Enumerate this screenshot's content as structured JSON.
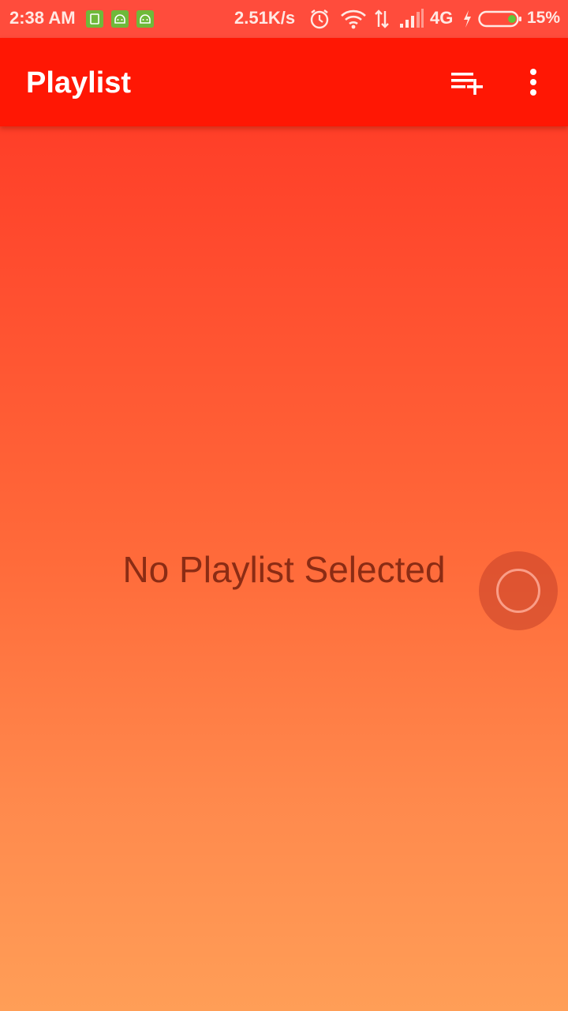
{
  "status_bar": {
    "time": "2:38 AM",
    "notification_icons": [
      "sim-card-icon",
      "android-icon",
      "android-icon"
    ],
    "network_speed": "2.51K/s",
    "network_type": "4G",
    "battery_percent": "15%",
    "battery_level": 0.15,
    "icons": [
      "alarm-icon",
      "wifi-icon",
      "data-arrows-icon",
      "signal-icon",
      "charging-icon",
      "battery-icon"
    ]
  },
  "app_bar": {
    "title": "Playlist",
    "actions": [
      "playlist-add-icon",
      "more-vert-icon"
    ],
    "color": "#ff1704"
  },
  "main": {
    "empty_message": "No Playlist Selected"
  },
  "colors": {
    "gradient_top": "#ff3222",
    "gradient_bottom": "#ff9e57",
    "empty_text": "#8b2c14"
  }
}
